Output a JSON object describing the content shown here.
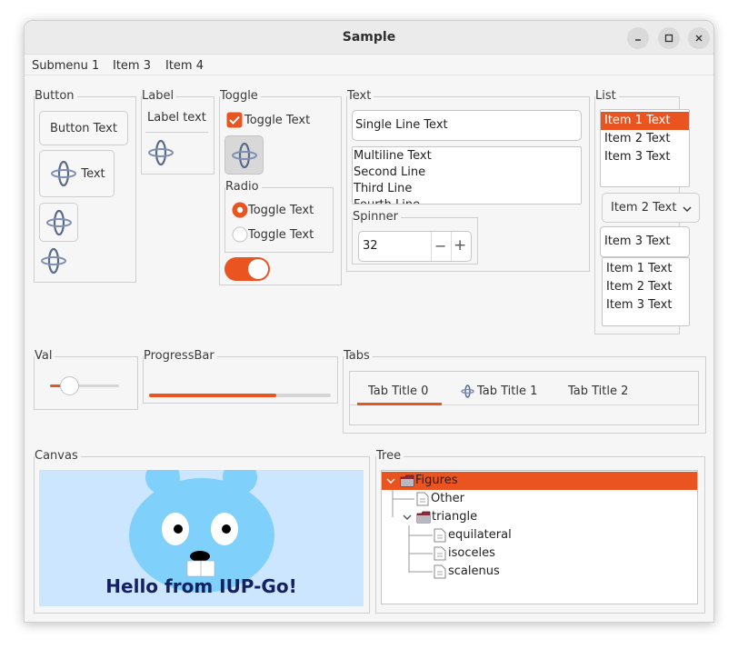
{
  "window": {
    "title": "Sample"
  },
  "menu": {
    "items": [
      "Submenu 1",
      "Item 3",
      "Item 4"
    ]
  },
  "button_frame": {
    "title": "Button",
    "text_button": "Button Text",
    "icon_text_button": "Text"
  },
  "label_frame": {
    "title": "Label",
    "label": "Label text"
  },
  "toggle_frame": {
    "title": "Toggle",
    "check_label": "Toggle Text",
    "checked": true
  },
  "radio_frame": {
    "title": "Radio",
    "options": [
      "Toggle Text",
      "Toggle Text"
    ],
    "selected_index": 0
  },
  "switch": {
    "on": true
  },
  "text_frame": {
    "title": "Text",
    "single_line": "Single Line Text",
    "multiline": [
      "Multiline Text",
      "Second Line",
      "Third Line",
      "Fourth Line"
    ]
  },
  "spinner": {
    "title": "Spinner",
    "value": "32",
    "minus": "−",
    "plus": "+"
  },
  "list_frame": {
    "title": "List",
    "list1": [
      "Item 1 Text",
      "Item 2 Text",
      "Item 3 Text"
    ],
    "list1_selected": 0,
    "dropdown_value": "Item 2 Text",
    "edit_value": "Item 3 Text",
    "list2": [
      "Item 1 Text",
      "Item 2 Text",
      "Item 3 Text"
    ]
  },
  "val_frame": {
    "title": "Val",
    "value": 0.28
  },
  "progress_frame": {
    "title": "ProgressBar",
    "value": 0.7
  },
  "tabs_frame": {
    "title": "Tabs",
    "tabs": [
      "Tab Title 0",
      "Tab Title 1",
      "Tab Title 2"
    ],
    "active": 0
  },
  "canvas_frame": {
    "title": "Canvas",
    "caption": "Hello from IUP-Go!"
  },
  "tree_frame": {
    "title": "Tree",
    "nodes": [
      {
        "label": "Figures",
        "icon": "folder-icon",
        "selected": true
      },
      {
        "label": "Other",
        "icon": "file-icon"
      },
      {
        "label": "triangle",
        "icon": "folder-icon"
      },
      {
        "label": "equilateral",
        "icon": "file-icon"
      },
      {
        "label": "isoceles",
        "icon": "file-icon"
      },
      {
        "label": "scalenus",
        "icon": "file-icon"
      }
    ]
  },
  "colors": {
    "accent": "#e95420",
    "canvas_bg": "#cce6ff",
    "gopher": "#7fd0fb",
    "caption": "#142063"
  }
}
